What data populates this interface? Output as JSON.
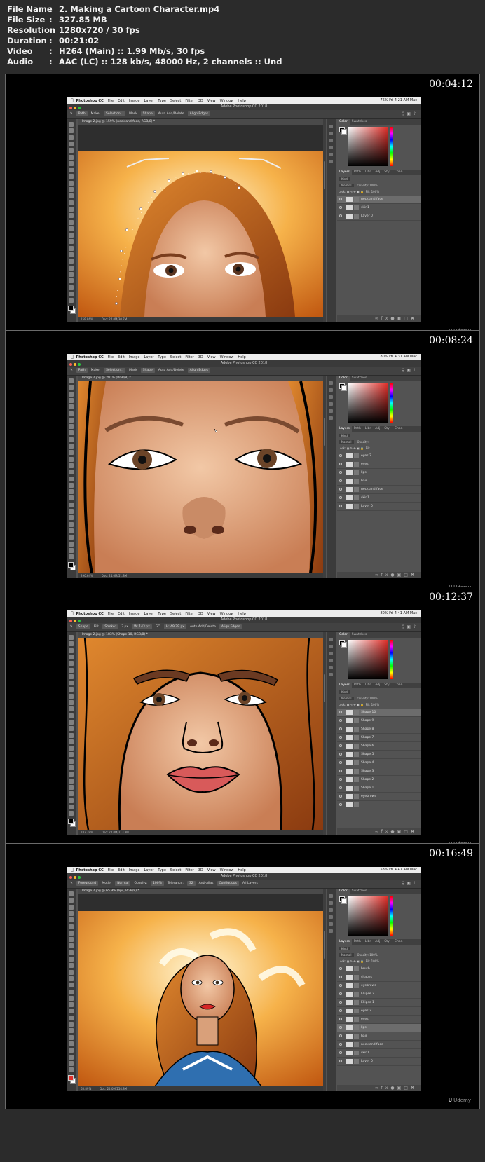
{
  "meta": [
    {
      "key": "File Name",
      "value": "2. Making a Cartoon Character.mp4"
    },
    {
      "key": "File Size",
      "value": "327.85 MB"
    },
    {
      "key": "Resolution",
      "value": "1280x720 / 30 fps"
    },
    {
      "key": "Duration",
      "value": "00:21:02"
    },
    {
      "key": "Video",
      "value": "H264 (Main) :: 1.99 Mb/s, 30 fps"
    },
    {
      "key": "Audio",
      "value": "AAC (LC) :: 128 kb/s, 48000 Hz, 2 channels :: Und"
    }
  ],
  "meta_colon": ":",
  "frames": [
    {
      "timestamp": "00:04:12",
      "app_name": "Photoshop CC",
      "window_title": "Adobe Photoshop CC 2018",
      "menu": [
        "File",
        "Edit",
        "Image",
        "Layer",
        "Type",
        "Select",
        "Filter",
        "3D",
        "View",
        "Window",
        "Help"
      ],
      "menubar_right": "76%  Fri 4:21 AM  Mac",
      "options": [
        "Path",
        "Make:",
        "Selection...",
        "Mask",
        "Shape",
        "Auto Add/Delete",
        "Align Edges"
      ],
      "doc_tab": "Image 2.jpg @ 159% (neck and face, RGB/8) *",
      "zoom": "159.86%",
      "doc_size": "Doc: 24.0M/30.7M",
      "layer_tabs": [
        "Layers",
        "Path",
        "Libr",
        "Adj",
        "Styl",
        "Chan"
      ],
      "filter_label": "Kind",
      "blend_mode": "Normal",
      "opacity_label": "Opacity:",
      "opacity": "100%",
      "lock_label": "Lock:",
      "fill_label": "Fill:",
      "fill": "100%",
      "layers": [
        "neck and face",
        "skin1",
        "Layer 0"
      ],
      "selected_layer": 0
    },
    {
      "timestamp": "00:08:24",
      "app_name": "Photoshop CC",
      "window_title": "Adobe Photoshop CC 2018",
      "menu": [
        "File",
        "Edit",
        "Image",
        "Layer",
        "Type",
        "Select",
        "Filter",
        "3D",
        "View",
        "Window",
        "Help"
      ],
      "menubar_right": "80%  Fri 4:31 AM  Mac",
      "options": [
        "Path",
        "Make:",
        "Selection...",
        "Mask",
        "Shape",
        "Auto Add/Delete",
        "Align Edges"
      ],
      "doc_tab": "Image 2.jpg @ 291% (RGB/8) *",
      "zoom": "290.64%",
      "doc_size": "Doc: 24.0M/51.8M",
      "layer_tabs": [
        "Layers",
        "Path",
        "Libr",
        "Adj",
        "Styl",
        "Chan"
      ],
      "filter_label": "Kind",
      "blend_mode": "Normal",
      "opacity_label": "Opacity:",
      "opacity": "",
      "lock_label": "Lock:",
      "fill_label": "Fill:",
      "fill": "",
      "layers": [
        "eyes 2",
        "eyes",
        "lips",
        "hair",
        "neck and face",
        "skin1",
        "Layer 0"
      ],
      "selected_layer": -1
    },
    {
      "timestamp": "00:12:37",
      "app_name": "Photoshop CC",
      "window_title": "Adobe Photoshop CC 2018",
      "menu": [
        "File",
        "Edit",
        "Image",
        "Layer",
        "Type",
        "Select",
        "Filter",
        "3D",
        "View",
        "Window",
        "Help"
      ],
      "menubar_right": "80%  Fri 4:41 AM  Mac",
      "options": [
        "Shape",
        "Fill:",
        "Stroke:",
        "3 px",
        "W: 143 px",
        "GO",
        "H: 49.79 px",
        "Auto Add/Delete",
        "Align Edges"
      ],
      "doc_tab": "Image 2.jpg @ 183% (Shape 10, RGB/8) *",
      "zoom": "183.39%",
      "doc_size": "Doc: 24.0M/213.8M",
      "layer_tabs": [
        "Layers",
        "Path",
        "Libr",
        "Adj",
        "Styl",
        "Chan"
      ],
      "filter_label": "Kind",
      "blend_mode": "Normal",
      "opacity_label": "Opacity:",
      "opacity": "100%",
      "lock_label": "Lock:",
      "fill_label": "Fill:",
      "fill": "100%",
      "layers": [
        "Shape 10",
        "Shape 9",
        "Shape 8",
        "Shape 7",
        "Shape 6",
        "Shape 5",
        "Shape 4",
        "Shape 3",
        "Shape 2",
        "Shape 1",
        "eyebrows",
        ""
      ],
      "selected_layer": 0
    },
    {
      "timestamp": "00:16:49",
      "app_name": "Photoshop CC",
      "window_title": "Adobe Photoshop CC 2018",
      "menu": [
        "File",
        "Edit",
        "Image",
        "Layer",
        "Type",
        "Select",
        "Filter",
        "3D",
        "View",
        "Window",
        "Help"
      ],
      "menubar_right": "53%  Fri 4:47 AM  Mac",
      "options": [
        "Foreground",
        "Mode:",
        "Normal",
        "Opacity:",
        "100%",
        "Tolerance:",
        "32",
        "Anti-alias",
        "Contiguous",
        "All Layers"
      ],
      "doc_tab": "Image 2.jpg @ 65.9% (lips, RGB/8) *",
      "zoom": "65.89%",
      "doc_size": "Doc: 24.0M/254.8M",
      "layer_tabs": [
        "Layers",
        "Path",
        "Libr",
        "Adj",
        "Styl",
        "Chan"
      ],
      "filter_label": "Kind",
      "blend_mode": "Normal",
      "opacity_label": "Opacity:",
      "opacity": "100%",
      "lock_label": "Lock:",
      "fill_label": "Fill:",
      "fill": "100%",
      "layers": [
        "brush",
        "shapes",
        "eyebrows",
        "Ellipse 2",
        "Ellipse 1",
        "eyes 2",
        "eyes",
        "lips",
        "hair",
        "neck and face",
        "skin1",
        "Layer 0"
      ],
      "selected_layer": 7
    }
  ],
  "watermark": "Udemy",
  "colors": {
    "page_bg": "#2b2b2b",
    "frame_bg": "#000000",
    "ps_ui": "#535353",
    "accent_red": "#e0302a"
  }
}
